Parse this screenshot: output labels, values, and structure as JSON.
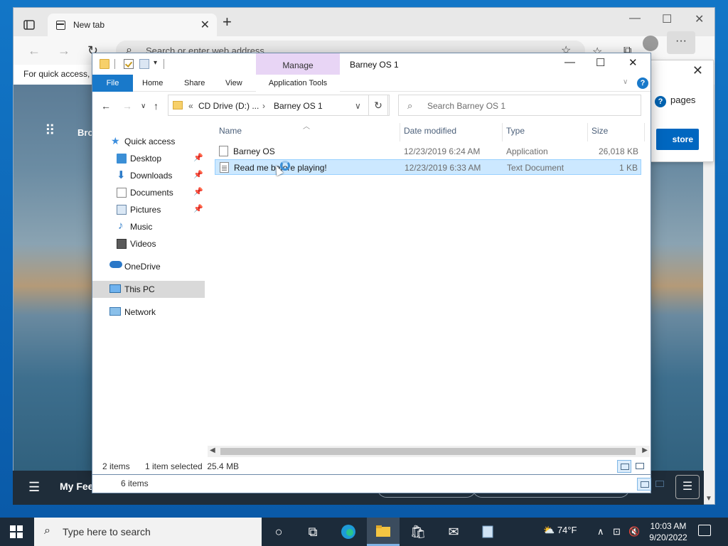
{
  "browser": {
    "tab_title": "New tab",
    "address_placeholder": "Search or enter web address",
    "favbar_text": "For quick access, p",
    "side_text": "Bro",
    "feed_label": "My Feed",
    "popup_text": "pages",
    "popup_button": "store"
  },
  "explorer": {
    "window_title": "Barney OS 1",
    "manage_tab": "Manage",
    "ribbon_tabs": [
      "File",
      "Home",
      "Share",
      "View",
      "Application Tools"
    ],
    "path_prefix": "«",
    "breadcrumbs": [
      "CD Drive (D:) ...",
      "Barney OS 1"
    ],
    "search_placeholder": "Search Barney OS 1",
    "nav_items": [
      {
        "label": "Quick access",
        "icon": "star-icon"
      },
      {
        "label": "Desktop",
        "icon": "desktop-icon",
        "pinned": true
      },
      {
        "label": "Downloads",
        "icon": "download-icon",
        "pinned": true
      },
      {
        "label": "Documents",
        "icon": "document-icon",
        "pinned": true
      },
      {
        "label": "Pictures",
        "icon": "picture-icon",
        "pinned": true
      },
      {
        "label": "Music",
        "icon": "music-icon"
      },
      {
        "label": "Videos",
        "icon": "video-icon"
      },
      {
        "label": "OneDrive",
        "icon": "cloud-icon"
      },
      {
        "label": "This PC",
        "icon": "computer-icon",
        "selected": true
      },
      {
        "label": "Network",
        "icon": "network-icon"
      }
    ],
    "columns": [
      "Name",
      "Date modified",
      "Type",
      "Size"
    ],
    "files": [
      {
        "name": "Barney OS",
        "date": "12/23/2019 6:24 AM",
        "type": "Application",
        "size": "26,018 KB",
        "selected": false
      },
      {
        "name": "Read me before playing!",
        "date": "12/23/2019 6:33 AM",
        "type": "Text Document",
        "size": "1 KB",
        "selected": true
      }
    ],
    "status": {
      "items": "2 items",
      "selection": "1 item selected  25.4 MB"
    },
    "behind_status": "6 items"
  },
  "taskbar": {
    "search_placeholder": "Type here to search",
    "temperature": "74°F",
    "time": "10:03 AM",
    "date": "9/20/2022"
  },
  "colors": {
    "accent": "#1979ca",
    "selection": "#cce8ff",
    "manage": "#e8d5f5"
  }
}
